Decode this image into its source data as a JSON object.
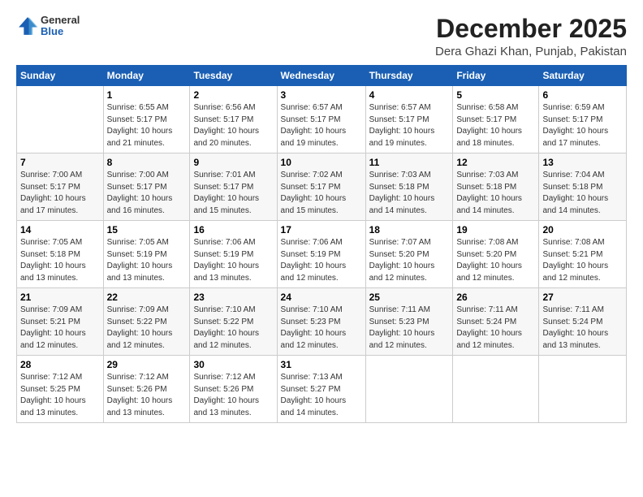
{
  "logo": {
    "general": "General",
    "blue": "Blue"
  },
  "header": {
    "title": "December 2025",
    "subtitle": "Dera Ghazi Khan, Punjab, Pakistan"
  },
  "columns": [
    "Sunday",
    "Monday",
    "Tuesday",
    "Wednesday",
    "Thursday",
    "Friday",
    "Saturday"
  ],
  "weeks": [
    [
      {
        "day": "",
        "sunrise": "",
        "sunset": "",
        "daylight": ""
      },
      {
        "day": "1",
        "sunrise": "Sunrise: 6:55 AM",
        "sunset": "Sunset: 5:17 PM",
        "daylight": "Daylight: 10 hours and 21 minutes."
      },
      {
        "day": "2",
        "sunrise": "Sunrise: 6:56 AM",
        "sunset": "Sunset: 5:17 PM",
        "daylight": "Daylight: 10 hours and 20 minutes."
      },
      {
        "day": "3",
        "sunrise": "Sunrise: 6:57 AM",
        "sunset": "Sunset: 5:17 PM",
        "daylight": "Daylight: 10 hours and 19 minutes."
      },
      {
        "day": "4",
        "sunrise": "Sunrise: 6:57 AM",
        "sunset": "Sunset: 5:17 PM",
        "daylight": "Daylight: 10 hours and 19 minutes."
      },
      {
        "day": "5",
        "sunrise": "Sunrise: 6:58 AM",
        "sunset": "Sunset: 5:17 PM",
        "daylight": "Daylight: 10 hours and 18 minutes."
      },
      {
        "day": "6",
        "sunrise": "Sunrise: 6:59 AM",
        "sunset": "Sunset: 5:17 PM",
        "daylight": "Daylight: 10 hours and 17 minutes."
      }
    ],
    [
      {
        "day": "7",
        "sunrise": "Sunrise: 7:00 AM",
        "sunset": "Sunset: 5:17 PM",
        "daylight": "Daylight: 10 hours and 17 minutes."
      },
      {
        "day": "8",
        "sunrise": "Sunrise: 7:00 AM",
        "sunset": "Sunset: 5:17 PM",
        "daylight": "Daylight: 10 hours and 16 minutes."
      },
      {
        "day": "9",
        "sunrise": "Sunrise: 7:01 AM",
        "sunset": "Sunset: 5:17 PM",
        "daylight": "Daylight: 10 hours and 15 minutes."
      },
      {
        "day": "10",
        "sunrise": "Sunrise: 7:02 AM",
        "sunset": "Sunset: 5:17 PM",
        "daylight": "Daylight: 10 hours and 15 minutes."
      },
      {
        "day": "11",
        "sunrise": "Sunrise: 7:03 AM",
        "sunset": "Sunset: 5:18 PM",
        "daylight": "Daylight: 10 hours and 14 minutes."
      },
      {
        "day": "12",
        "sunrise": "Sunrise: 7:03 AM",
        "sunset": "Sunset: 5:18 PM",
        "daylight": "Daylight: 10 hours and 14 minutes."
      },
      {
        "day": "13",
        "sunrise": "Sunrise: 7:04 AM",
        "sunset": "Sunset: 5:18 PM",
        "daylight": "Daylight: 10 hours and 14 minutes."
      }
    ],
    [
      {
        "day": "14",
        "sunrise": "Sunrise: 7:05 AM",
        "sunset": "Sunset: 5:18 PM",
        "daylight": "Daylight: 10 hours and 13 minutes."
      },
      {
        "day": "15",
        "sunrise": "Sunrise: 7:05 AM",
        "sunset": "Sunset: 5:19 PM",
        "daylight": "Daylight: 10 hours and 13 minutes."
      },
      {
        "day": "16",
        "sunrise": "Sunrise: 7:06 AM",
        "sunset": "Sunset: 5:19 PM",
        "daylight": "Daylight: 10 hours and 13 minutes."
      },
      {
        "day": "17",
        "sunrise": "Sunrise: 7:06 AM",
        "sunset": "Sunset: 5:19 PM",
        "daylight": "Daylight: 10 hours and 12 minutes."
      },
      {
        "day": "18",
        "sunrise": "Sunrise: 7:07 AM",
        "sunset": "Sunset: 5:20 PM",
        "daylight": "Daylight: 10 hours and 12 minutes."
      },
      {
        "day": "19",
        "sunrise": "Sunrise: 7:08 AM",
        "sunset": "Sunset: 5:20 PM",
        "daylight": "Daylight: 10 hours and 12 minutes."
      },
      {
        "day": "20",
        "sunrise": "Sunrise: 7:08 AM",
        "sunset": "Sunset: 5:21 PM",
        "daylight": "Daylight: 10 hours and 12 minutes."
      }
    ],
    [
      {
        "day": "21",
        "sunrise": "Sunrise: 7:09 AM",
        "sunset": "Sunset: 5:21 PM",
        "daylight": "Daylight: 10 hours and 12 minutes."
      },
      {
        "day": "22",
        "sunrise": "Sunrise: 7:09 AM",
        "sunset": "Sunset: 5:22 PM",
        "daylight": "Daylight: 10 hours and 12 minutes."
      },
      {
        "day": "23",
        "sunrise": "Sunrise: 7:10 AM",
        "sunset": "Sunset: 5:22 PM",
        "daylight": "Daylight: 10 hours and 12 minutes."
      },
      {
        "day": "24",
        "sunrise": "Sunrise: 7:10 AM",
        "sunset": "Sunset: 5:23 PM",
        "daylight": "Daylight: 10 hours and 12 minutes."
      },
      {
        "day": "25",
        "sunrise": "Sunrise: 7:11 AM",
        "sunset": "Sunset: 5:23 PM",
        "daylight": "Daylight: 10 hours and 12 minutes."
      },
      {
        "day": "26",
        "sunrise": "Sunrise: 7:11 AM",
        "sunset": "Sunset: 5:24 PM",
        "daylight": "Daylight: 10 hours and 12 minutes."
      },
      {
        "day": "27",
        "sunrise": "Sunrise: 7:11 AM",
        "sunset": "Sunset: 5:24 PM",
        "daylight": "Daylight: 10 hours and 13 minutes."
      }
    ],
    [
      {
        "day": "28",
        "sunrise": "Sunrise: 7:12 AM",
        "sunset": "Sunset: 5:25 PM",
        "daylight": "Daylight: 10 hours and 13 minutes."
      },
      {
        "day": "29",
        "sunrise": "Sunrise: 7:12 AM",
        "sunset": "Sunset: 5:26 PM",
        "daylight": "Daylight: 10 hours and 13 minutes."
      },
      {
        "day": "30",
        "sunrise": "Sunrise: 7:12 AM",
        "sunset": "Sunset: 5:26 PM",
        "daylight": "Daylight: 10 hours and 13 minutes."
      },
      {
        "day": "31",
        "sunrise": "Sunrise: 7:13 AM",
        "sunset": "Sunset: 5:27 PM",
        "daylight": "Daylight: 10 hours and 14 minutes."
      },
      {
        "day": "",
        "sunrise": "",
        "sunset": "",
        "daylight": ""
      },
      {
        "day": "",
        "sunrise": "",
        "sunset": "",
        "daylight": ""
      },
      {
        "day": "",
        "sunrise": "",
        "sunset": "",
        "daylight": ""
      }
    ]
  ]
}
